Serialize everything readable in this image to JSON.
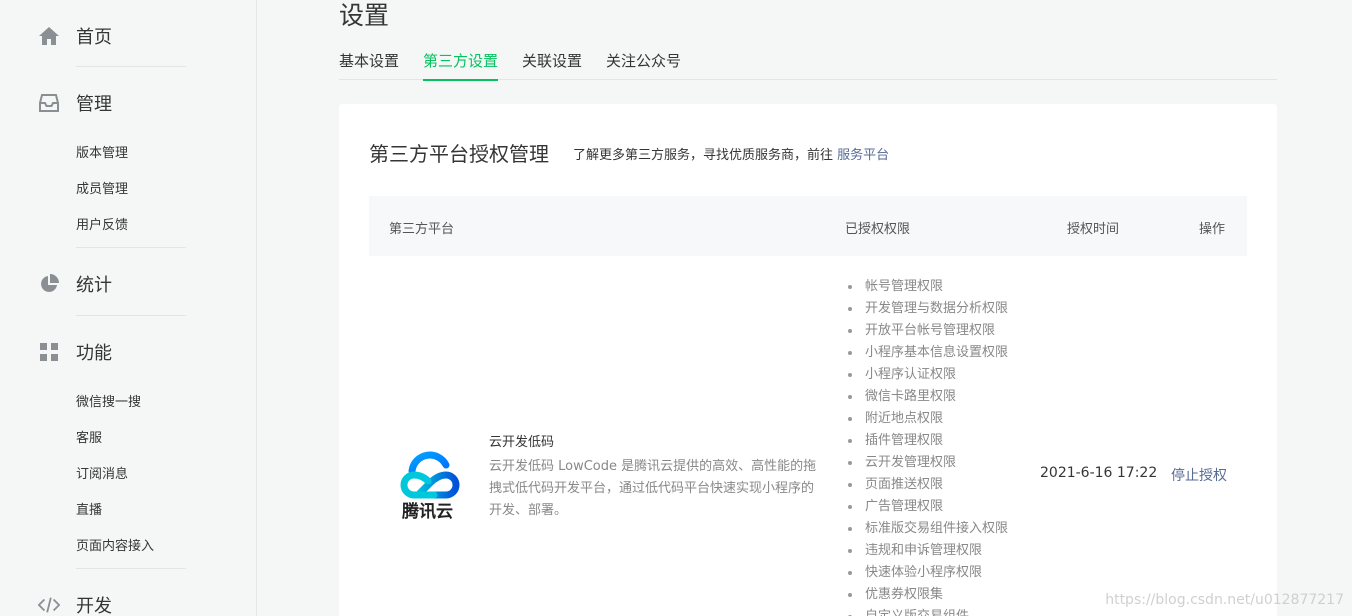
{
  "sidebar": {
    "home": {
      "label": "首页",
      "icon": "home-icon"
    },
    "manage": {
      "label": "管理",
      "icon": "inbox-icon",
      "items": [
        "版本管理",
        "成员管理",
        "用户反馈"
      ]
    },
    "stats": {
      "label": "统计",
      "icon": "pie-chart-icon"
    },
    "features": {
      "label": "功能",
      "icon": "grid-icon",
      "items": [
        "微信搜一搜",
        "客服",
        "订阅消息",
        "直播",
        "页面内容接入"
      ]
    },
    "dev": {
      "label": "开发",
      "icon": "code-icon"
    }
  },
  "page": {
    "title": "设置",
    "tabs": [
      {
        "label": "基本设置",
        "active": false
      },
      {
        "label": "第三方设置",
        "active": true
      },
      {
        "label": "关联设置",
        "active": false
      },
      {
        "label": "关注公众号",
        "active": false
      }
    ]
  },
  "card": {
    "title": "第三方平台授权管理",
    "tip_text": "了解更多第三方服务，寻找优质服务商，前往 ",
    "tip_link": "服务平台"
  },
  "table": {
    "headers": {
      "platform": "第三方平台",
      "permissions": "已授权权限",
      "time": "授权时间",
      "action": "操作"
    },
    "row": {
      "logo_text": "腾讯云",
      "app_name": "云开发低码",
      "app_desc": "云开发低码 LowCode 是腾讯云提供的高效、高性能的拖拽式低代码开发平台，通过低代码平台快速实现小程序的开发、部署。",
      "permissions": [
        "帐号管理权限",
        "开发管理与数据分析权限",
        "开放平台帐号管理权限",
        "小程序基本信息设置权限",
        "小程序认证权限",
        "微信卡路里权限",
        "附近地点权限",
        "插件管理权限",
        "云开发管理权限",
        "页面推送权限",
        "广告管理权限",
        "标准版交易组件接入权限",
        "违规和申诉管理权限",
        "快速体验小程序权限",
        "优惠券权限集",
        "自定义版交易组件"
      ],
      "auth_time": "2021-6-16 17:22",
      "action": "停止授权"
    }
  },
  "watermark": "https://blog.csdn.net/u012877217",
  "colors": {
    "accent": "#07c160",
    "link": "#576b95",
    "sidebar_bg": "#f5f7f7",
    "icon": "#8a8f94"
  }
}
